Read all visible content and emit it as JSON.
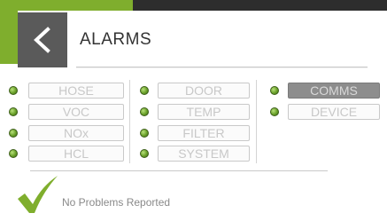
{
  "header": {
    "title": "ALARMS"
  },
  "columns": [
    {
      "items": [
        {
          "label": "HOSE",
          "active": false
        },
        {
          "label": "VOC",
          "active": false
        },
        {
          "label": "NOx",
          "active": false
        },
        {
          "label": "HCL",
          "active": false
        }
      ]
    },
    {
      "items": [
        {
          "label": "DOOR",
          "active": false
        },
        {
          "label": "TEMP",
          "active": false
        },
        {
          "label": "FILTER",
          "active": false
        },
        {
          "label": "SYSTEM",
          "active": false
        }
      ]
    },
    {
      "items": [
        {
          "label": "COMMS",
          "active": true
        },
        {
          "label": "DEVICE",
          "active": false
        }
      ]
    }
  ],
  "status": {
    "message": "No Problems Reported"
  },
  "colors": {
    "accent": "#7fae2d",
    "led_ok": "#6aa12a",
    "active_button": "#8d8d8d"
  },
  "icons": {
    "back": "chevron-left-icon",
    "led": "status-led-icon",
    "status": "checkmark-icon"
  }
}
